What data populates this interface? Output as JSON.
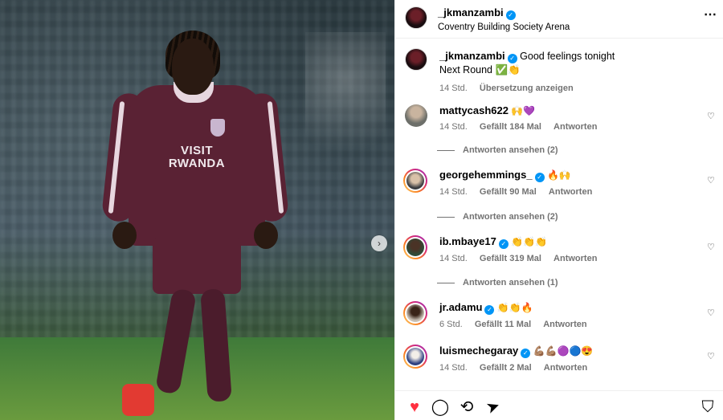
{
  "post": {
    "username": "_jkmanzambi",
    "location": "Coventry Building Society Arena",
    "sponsor": "VISIT RWANDA",
    "caption_line1": "Good feelings tonight",
    "caption_line2": "Next Round ✅👏",
    "time": "14 Std.",
    "translate": "Übersetzung anzeigen"
  },
  "comments": [
    {
      "username": "mattycash622",
      "verified": false,
      "text": "🙌💜",
      "time": "14 Std.",
      "likes": "Gefällt 184 Mal",
      "reply": "Antworten",
      "view_replies": "Antworten ansehen (2)"
    },
    {
      "username": "georgehemmings_",
      "verified": true,
      "text": "🔥🙌",
      "time": "14 Std.",
      "likes": "Gefällt 90 Mal",
      "reply": "Antworten",
      "view_replies": "Antworten ansehen (2)"
    },
    {
      "username": "ib.mbaye17",
      "verified": true,
      "text": "👏👏👏",
      "time": "14 Std.",
      "likes": "Gefällt 319 Mal",
      "reply": "Antworten",
      "view_replies": "Antworten ansehen (1)"
    },
    {
      "username": "jr.adamu",
      "verified": true,
      "text": "👏👏🔥",
      "time": "6 Std.",
      "likes": "Gefällt 11 Mal",
      "reply": "Antworten",
      "view_replies": ""
    },
    {
      "username": "luismechegaray",
      "verified": true,
      "text": "💪🏽💪🏽🟣🔵😍",
      "time": "14 Std.",
      "likes": "Gefällt 2 Mal",
      "reply": "Antworten",
      "view_replies": ""
    }
  ],
  "icons": {
    "more": "⋯",
    "next": "›",
    "heart_small": "♡",
    "heart_filled": "♥",
    "comment": "◯",
    "repost": "⟲",
    "share": "➤",
    "bookmark": "⛉"
  },
  "colors": {
    "accent": "#0095f6",
    "like": "#ff3040"
  }
}
